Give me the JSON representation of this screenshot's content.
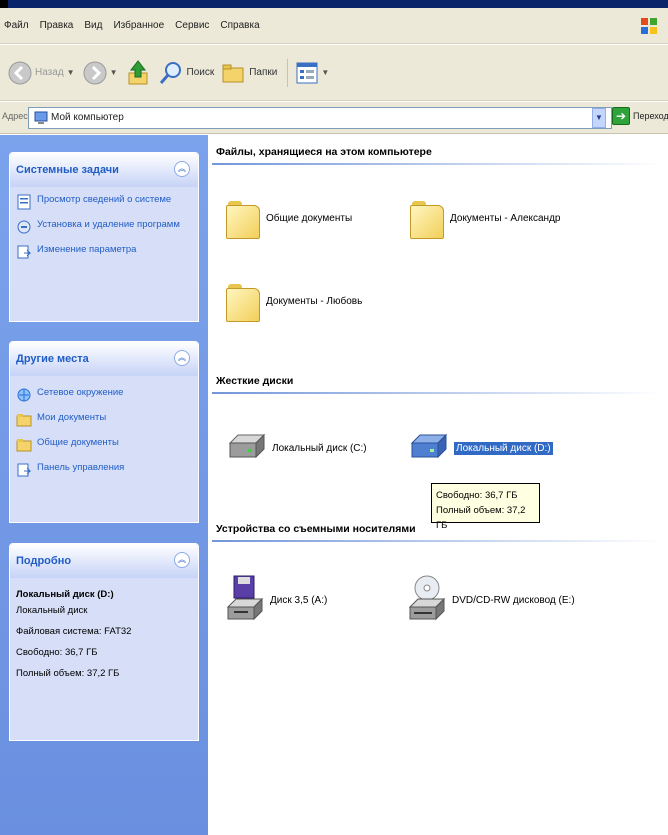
{
  "menu": [
    "Файл",
    "Правка",
    "Вид",
    "Избранное",
    "Сервис",
    "Справка"
  ],
  "toolbar": {
    "back_label": "Назад",
    "search_label": "Поиск",
    "folders_label": "Папки"
  },
  "address": {
    "label": "Адрес:",
    "value": "Мой компьютер",
    "go_label": "Переход"
  },
  "panels": {
    "system_tasks": {
      "title": "Системные задачи",
      "items": [
        "Просмотр сведений о системе",
        "Установка и удаление программ",
        "Изменение параметра"
      ]
    },
    "other_places": {
      "title": "Другие места",
      "items": [
        "Сетевое окружение",
        "Мои документы",
        "Общие документы",
        "Панель управления"
      ]
    },
    "details": {
      "title": "Подробно",
      "name": "Локальный диск (D:)",
      "type": "Локальный диск",
      "filesystem": "Файловая система: FAT32",
      "free": "Свободно: 36,7 ГБ",
      "total": "Полный объем: 37,2 ГБ"
    }
  },
  "groups": {
    "files": {
      "title": "Файлы, хранящиеся на этом компьютере",
      "items": [
        "Общие документы",
        "Документы - Александр",
        "Документы - Любовь"
      ]
    },
    "drives": {
      "title": "Жесткие диски",
      "items": [
        "Локальный диск (C:)",
        "Локальный диск (D:)"
      ]
    },
    "removable": {
      "title": "Устройства со съемными носителями",
      "items": [
        "Диск 3,5 (A:)",
        "DVD/CD-RW дисковод (E:)"
      ]
    }
  },
  "tooltip": {
    "free": "Свободно: 36,7 ГБ",
    "total": "Полный объем: 37,2 ГБ"
  },
  "colors": {
    "taskpane": "#6a8fe0",
    "link": "#215dc6",
    "selection": "#316ac5"
  }
}
